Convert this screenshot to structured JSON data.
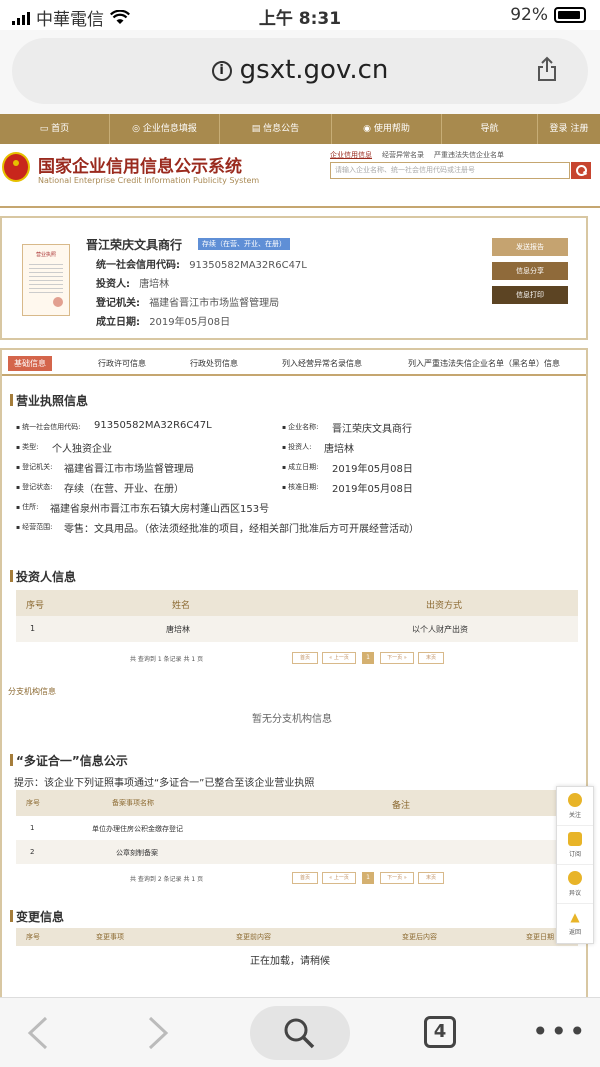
{
  "status_bar": {
    "carrier": "中華電信",
    "time": "上午 8:31",
    "battery": "92%"
  },
  "browser": {
    "url": "gsxt.gov.cn",
    "tab_count": "4"
  },
  "nav": {
    "items": [
      "首页",
      "企业信息填报",
      "信息公告",
      "使用帮助",
      "导航"
    ],
    "login": "登录",
    "register": "注册"
  },
  "site": {
    "title": "国家企业信用信息公示系统",
    "subtitle": "National Enterprise Credit Information Publicity System",
    "search_tabs": [
      "企业信用信息",
      "经营异常名录",
      "严重违法失信企业名单"
    ],
    "search_placeholder": "请输入企业名称、统一社会信用代码或注册号"
  },
  "company": {
    "name": "晋江荣庆文具商行",
    "status_badge": "存续（在营、开业、在册）",
    "license_thumb_label": "营业执照",
    "fields": [
      {
        "label": "统一社会信用代码:",
        "value": "91350582MA32R6C47L"
      },
      {
        "label": "投资人:",
        "value": "唐培林"
      },
      {
        "label": "登记机关:",
        "value": "福建省晋江市市场监督管理局"
      },
      {
        "label": "成立日期:",
        "value": "2019年05月08日"
      }
    ],
    "buttons": [
      "发送报告",
      "信息分享",
      "信息打印"
    ]
  },
  "tabs": [
    "基础信息",
    "行政许可信息",
    "行政处罚信息",
    "列入经营异常名录信息",
    "列入严重违法失信企业名单（黑名单）信息"
  ],
  "license": {
    "heading": "营业执照信息",
    "fields": [
      {
        "label": "统一社会信用代码:",
        "value": "91350582MA32R6C47L"
      },
      {
        "label": "企业名称:",
        "value": "晋江荣庆文具商行"
      },
      {
        "label": "类型:",
        "value": "个人独资企业"
      },
      {
        "label": "投资人:",
        "value": "唐培林"
      },
      {
        "label": "登记机关:",
        "value": "福建省晋江市市场监督管理局"
      },
      {
        "label": "成立日期:",
        "value": "2019年05月08日"
      },
      {
        "label": "登记状态:",
        "value": "存续（在营、开业、在册）"
      },
      {
        "label": "核准日期:",
        "value": "2019年05月08日"
      },
      {
        "label": "住所:",
        "value": "福建省泉州市晋江市东石镇大房村蓬山西区153号"
      },
      {
        "label": "经营范围:",
        "value": "零售：文具用品。（依法须经批准的项目，经相关部门批准后方可开展经营活动）"
      }
    ]
  },
  "investors": {
    "heading": "投资人信息",
    "columns": [
      "序号",
      "姓名",
      "出资方式"
    ],
    "rows": [
      [
        "1",
        "唐培林",
        "以个人财产出资"
      ]
    ],
    "pagination_text": "共 查询到 1 条记录 共 1 页",
    "pager": [
      "首页",
      "« 上一页",
      "1",
      "下一页 »",
      "末页"
    ]
  },
  "branches": {
    "heading": "分支机构信息",
    "empty": "暂无分支机构信息"
  },
  "multi": {
    "heading": "“多证合一”信息公示",
    "note": "提示：该企业下列证照事项通过“多证合一”已整合至该企业营业执照",
    "columns": [
      "序号",
      "备案事项名称",
      "备注"
    ],
    "rows": [
      [
        "1",
        "单位办理住房公积金缴存登记"
      ],
      [
        "2",
        "公章刻制备案"
      ]
    ],
    "pagination_text": "共 查询到 2 条记录 共 1 页",
    "pager": [
      "首页",
      "« 上一页",
      "1",
      "下一页 »",
      "末页"
    ]
  },
  "changes": {
    "heading": "变更信息",
    "columns": [
      "序号",
      "变更事项",
      "变更前内容",
      "变更后内容",
      "变更日期"
    ],
    "loading": "正在加载，请稍候"
  },
  "float_menu": [
    "关注",
    "订阅",
    "异议",
    "返回"
  ]
}
